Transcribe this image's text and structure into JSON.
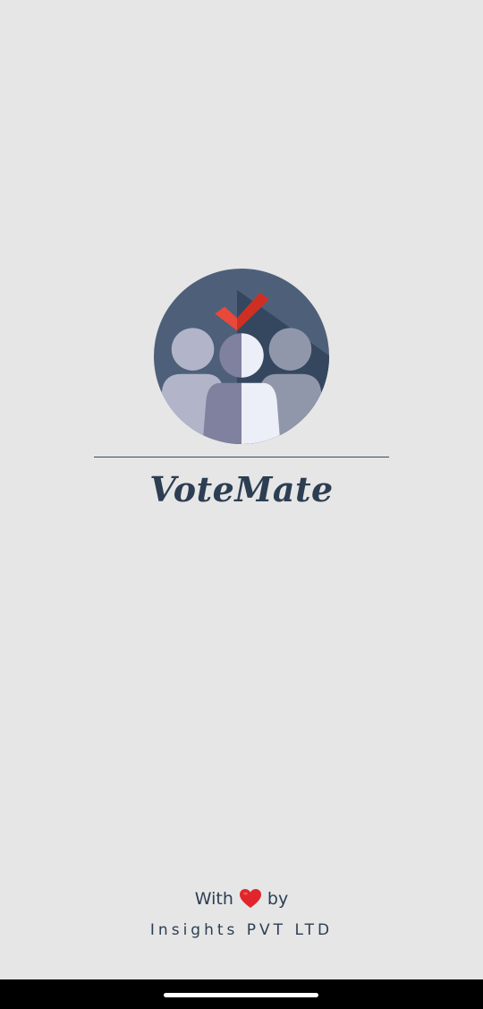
{
  "app": {
    "name": "VoteMate",
    "logo_icon": "voting-group-checkmark-icon"
  },
  "footer": {
    "with_text": "With",
    "heart_icon": "heart-icon",
    "by_text": "by",
    "company": "Insights PVT LTD"
  },
  "colors": {
    "background": "#e6e6e6",
    "brand_text": "#2d3e53",
    "logo_circle": "#4e6079",
    "check_red": "#e8493b",
    "heart_red": "#e0262b"
  }
}
